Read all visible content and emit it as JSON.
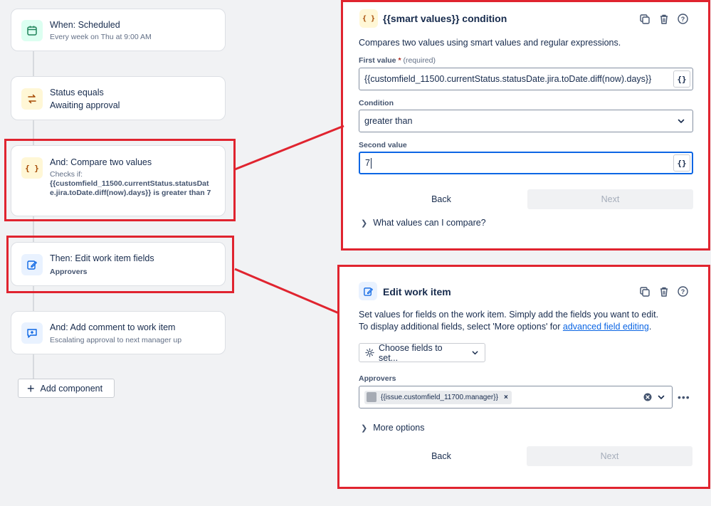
{
  "flow": {
    "steps": [
      {
        "title": "When: Scheduled",
        "subtitle": "Every week on Thu at 9:00 AM"
      },
      {
        "title": "Status equals",
        "subtitle": "Awaiting approval"
      },
      {
        "title": "And: Compare two values",
        "subtitle_prefix": "Checks if:",
        "subtitle_bold": "{{customfield_11500.currentStatus.statusDate.jira.toDate.diff(now).days}} is greater than 7"
      },
      {
        "title": "Then: Edit work item fields",
        "subtitle": "Approvers"
      },
      {
        "title": "And: Add comment to work item",
        "subtitle": "Escalating approval to next manager up"
      }
    ],
    "add_component_label": "Add component"
  },
  "condition_panel": {
    "title": "{{smart values}} condition",
    "description": "Compares two values using smart values and regular expressions.",
    "first_value_label": "First value",
    "required_mark": "*",
    "required_text": "(required)",
    "first_value": "{{customfield_11500.currentStatus.statusDate.jira.toDate.diff(now).days}}",
    "condition_label": "Condition",
    "condition_value": "greater than",
    "second_value_label": "Second value",
    "second_value": "7",
    "smart_button": "{}",
    "back_label": "Back",
    "next_label": "Next",
    "help_label": "What values can I compare?"
  },
  "edit_panel": {
    "title": "Edit work item",
    "description_line1": "Set values for fields on the work item. Simply add the fields you want to edit.",
    "description_line2_prefix": "To display additional fields, select 'More options' for ",
    "description_link": "advanced field editing",
    "description_line2_suffix": ".",
    "choose_fields_label": "Choose fields to set...",
    "approvers_label": "Approvers",
    "approver_tag": "{{issue.customfield_11700.manager}}",
    "more_options_label": "More options",
    "back_label": "Back",
    "next_label": "Next"
  },
  "colors": {
    "highlight": "#e0242f",
    "link": "#0c66e4",
    "focus": "#0c66e4",
    "trigger_icon_bg": "#dcfff1",
    "condition_icon_bg": "#fff7d6",
    "action_icon_bg": "#e9f2ff"
  },
  "icons": {
    "step1": "calendar-icon",
    "step2": "swap-arrows-icon",
    "step3": "braces-icon",
    "step4": "edit-icon",
    "step5": "add-comment-icon"
  }
}
